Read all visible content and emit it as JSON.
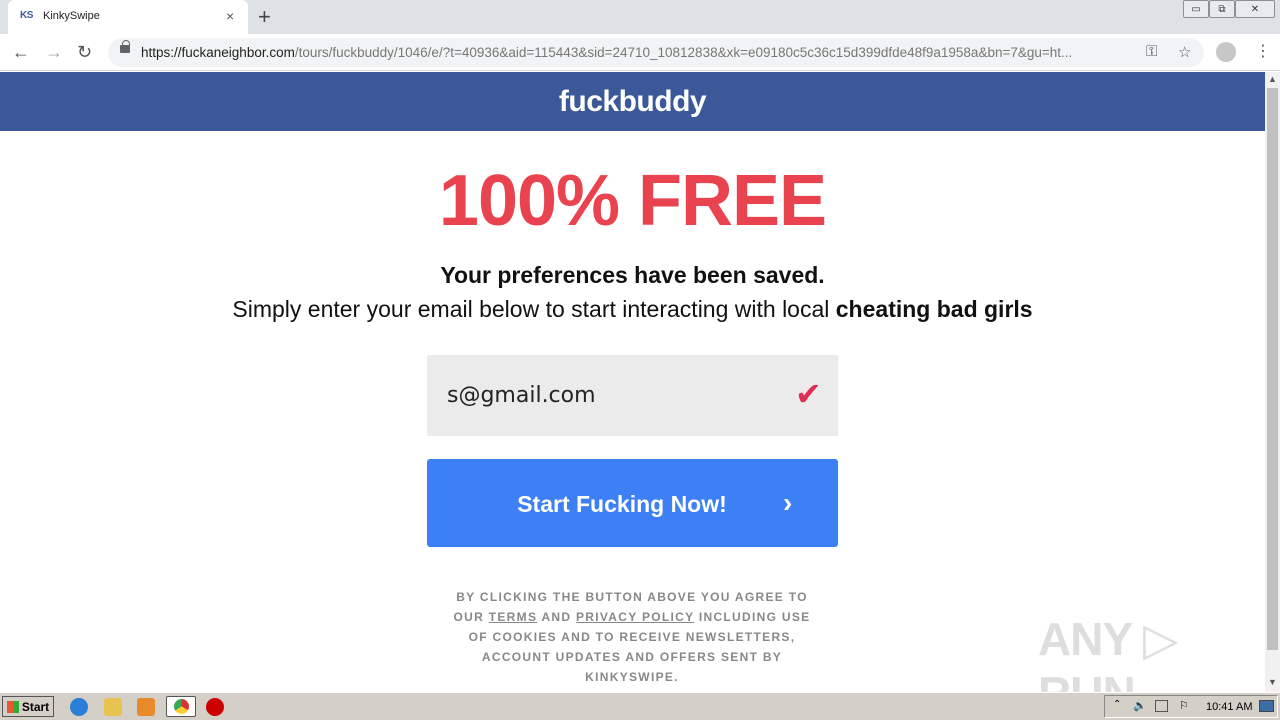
{
  "browser": {
    "tab_favicon": "KS",
    "tab_title": "KinkySwipe",
    "tab_close": "×",
    "new_tab": "+",
    "window_buttons": [
      "▭",
      "⧉",
      "✕"
    ],
    "nav": {
      "back": "←",
      "forward": "→",
      "reload": "↻"
    },
    "url_host": "https://fuckaneighbor.com",
    "url_path": "/tours/fuckbuddy/1046/e/?t=40936&aid=115443&sid=24710_10812838&xk=e09180c5c36c15d399dfde48f9a1958a&bn=7&gu=ht...",
    "key_icon": "⚿",
    "star_icon": "☆",
    "menu_icon": "⋮"
  },
  "page": {
    "brand": "fuckbuddy",
    "headline": "100% FREE",
    "saved": "Your preferences have been saved.",
    "sub_plain": "Simply enter your email below to start interacting with local ",
    "sub_bold": "cheating bad girls",
    "email_value": "s@gmail.com",
    "check_icon": "✔",
    "cta_label": "Start Fucking Now!",
    "cta_arrow": "›",
    "legal_1": "BY CLICKING THE BUTTON ABOVE YOU AGREE TO OUR ",
    "legal_terms": "TERMS",
    "legal_and": " AND ",
    "legal_privacy": "PRIVACY POLICY",
    "legal_2": " INCLUDING USE OF COOKIES AND TO RECEIVE NEWSLETTERS, ACCOUNT UPDATES AND OFFERS SENT BY KINKYSWIPE."
  },
  "scrollbar": {
    "up": "▲",
    "down": "▼"
  },
  "watermark": "ANY ▷ RUN",
  "taskbar": {
    "start_label": "Start",
    "clock": "10:41 AM",
    "icons": [
      "ie-icon",
      "explorer-icon",
      "media-player-icon",
      "chrome-icon",
      "stop-icon"
    ]
  }
}
